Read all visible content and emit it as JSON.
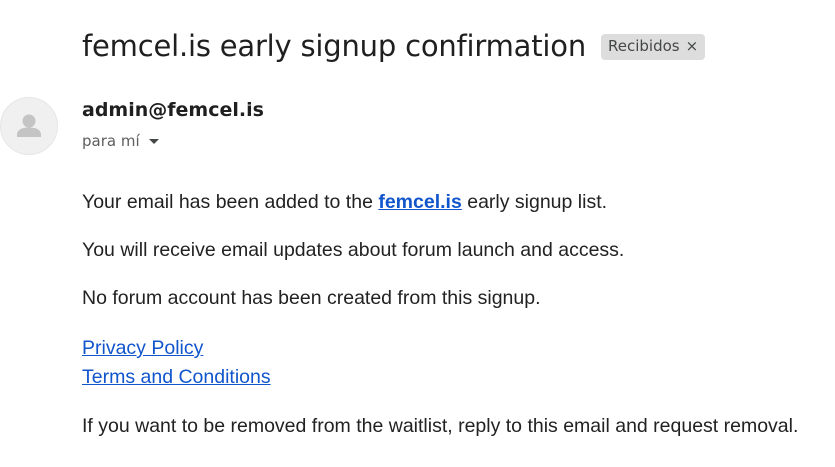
{
  "email": {
    "subject": "femcel.is early signup confirmation",
    "label": {
      "text": "Recibidos",
      "close_glyph": "×"
    },
    "sender": "admin@femcel.is",
    "recipient": "para mí",
    "avatar_icon": "person-icon",
    "body": {
      "p1_before": "Your email has been added to the ",
      "p1_link": "femcel.is",
      "p1_after": " early signup list.",
      "p2": "You will receive email updates about forum launch and access.",
      "p3": "No forum account has been created from this signup.",
      "links": {
        "privacy": "Privacy Policy",
        "terms": "Terms and Conditions"
      },
      "p4": "If you want to be removed from the waitlist, reply to this email and request removal."
    }
  },
  "colors": {
    "link": "#1155cc",
    "chip_bg": "#dddddd",
    "text": "#222222",
    "muted": "#5e5e5e"
  }
}
